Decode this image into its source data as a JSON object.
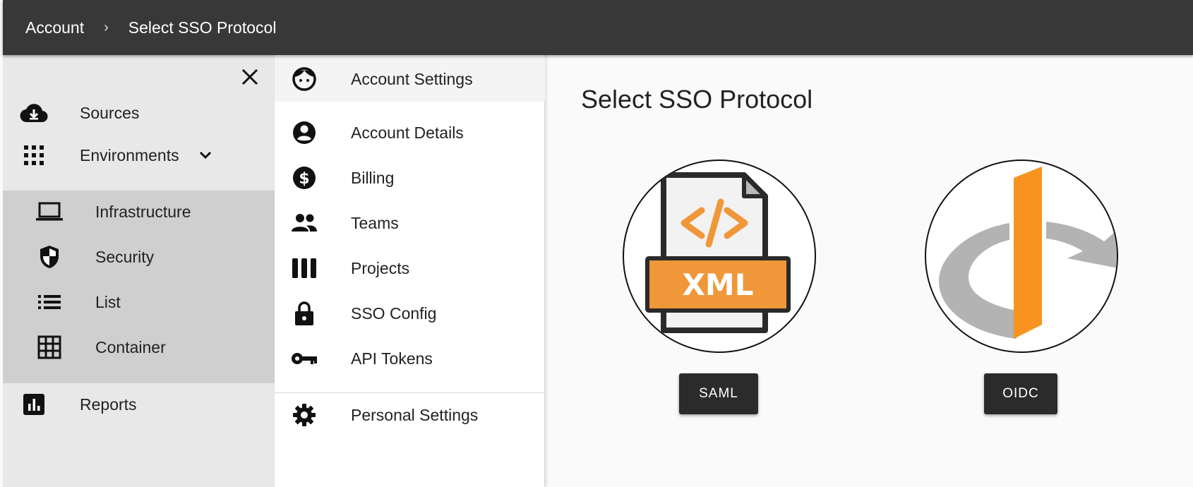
{
  "breadcrumb": {
    "root": "Account",
    "separator": "›",
    "current": "Select SSO Protocol"
  },
  "nav": {
    "items": [
      {
        "label": "Sources",
        "icon": "cloud-download-icon"
      },
      {
        "label": "Environments",
        "icon": "apps-grid-icon",
        "expanded": true
      },
      {
        "label": "Reports",
        "icon": "bar-chart-icon"
      }
    ],
    "sub_items": [
      {
        "label": "Infrastructure",
        "icon": "laptop-icon"
      },
      {
        "label": "Security",
        "icon": "shield-icon"
      },
      {
        "label": "List",
        "icon": "list-icon"
      },
      {
        "label": "Container",
        "icon": "grid-icon"
      }
    ]
  },
  "menu": {
    "items": [
      {
        "label": "Account Settings",
        "icon": "face-icon"
      },
      {
        "label": "Account Details",
        "icon": "account-circle-icon"
      },
      {
        "label": "Billing",
        "icon": "dollar-icon"
      },
      {
        "label": "Teams",
        "icon": "people-icon"
      },
      {
        "label": "Projects",
        "icon": "columns-icon"
      },
      {
        "label": "SSO Config",
        "icon": "lock-icon"
      },
      {
        "label": "API Tokens",
        "icon": "key-icon"
      },
      {
        "label": "Personal Settings",
        "icon": "gear-icon"
      }
    ]
  },
  "main": {
    "title": "Select SSO Protocol",
    "saml_logo_text": "XML",
    "saml_button": "SAML",
    "oidc_button": "OIDC"
  },
  "colors": {
    "topbar": "#383838",
    "accent_orange": "#f0973a",
    "oidc_orange": "#f7931e",
    "button": "#2b2b2b"
  }
}
